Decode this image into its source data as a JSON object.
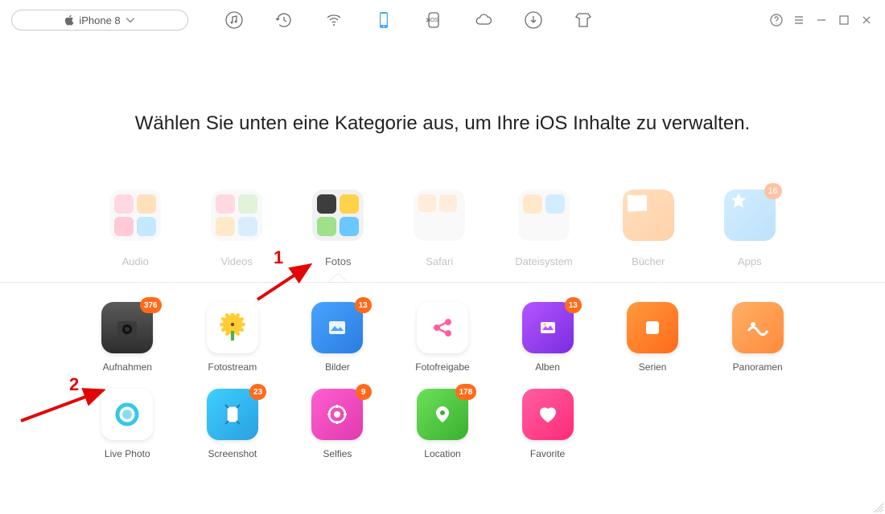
{
  "device": {
    "name": "iPhone 8"
  },
  "heading": "Wählen Sie unten eine Kategorie aus, um Ihre iOS Inhalte zu verwalten.",
  "toolbar": {
    "icons": [
      "music",
      "history",
      "wifi-sync",
      "phone",
      "ios-transfer",
      "cloud",
      "download",
      "skin"
    ],
    "active": "phone"
  },
  "categories": [
    {
      "id": "audio",
      "label": "Audio"
    },
    {
      "id": "videos",
      "label": "Videos"
    },
    {
      "id": "fotos",
      "label": "Fotos",
      "selected": true
    },
    {
      "id": "safari",
      "label": "Safari"
    },
    {
      "id": "filesystem",
      "label": "Dateisystem"
    },
    {
      "id": "books",
      "label": "Bücher"
    },
    {
      "id": "apps",
      "label": "Apps",
      "badge": "16"
    }
  ],
  "sub_items": [
    {
      "id": "aufnahmen",
      "label": "Aufnahmen",
      "badge": "376",
      "color": "camera"
    },
    {
      "id": "fotostream",
      "label": "Fotostream",
      "color": "sunflower"
    },
    {
      "id": "bilder",
      "label": "Bilder",
      "badge": "13",
      "color": "blue"
    },
    {
      "id": "fotofreigabe",
      "label": "Fotofreigabe",
      "color": "pink-share"
    },
    {
      "id": "alben",
      "label": "Alben",
      "badge": "13",
      "color": "purple"
    },
    {
      "id": "serien",
      "label": "Serien",
      "color": "orange"
    },
    {
      "id": "panoramen",
      "label": "Panoramen",
      "color": "orange-light"
    },
    {
      "id": "livephoto",
      "label": "Live Photo",
      "color": "white-ring"
    },
    {
      "id": "screenshot",
      "label": "Screenshot",
      "badge": "23",
      "color": "cyan"
    },
    {
      "id": "selfies",
      "label": "Selfies",
      "badge": "9",
      "color": "magenta"
    },
    {
      "id": "location",
      "label": "Location",
      "badge": "178",
      "color": "green"
    },
    {
      "id": "favorite",
      "label": "Favorite",
      "color": "hotpink"
    }
  ],
  "annotations": [
    {
      "num": "1",
      "target": "fotos"
    },
    {
      "num": "2",
      "target": "aufnahmen"
    }
  ]
}
